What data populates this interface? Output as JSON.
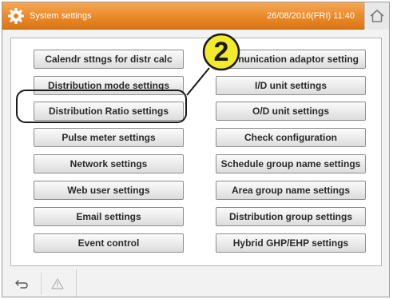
{
  "header": {
    "title": "System settings",
    "datetime": "26/08/2016(FRI) 11:40",
    "gear_icon": "gear-icon",
    "home_icon": "home-icon",
    "accent_color": "#ea8c2c"
  },
  "settings": {
    "left": [
      "Calendr sttngs for distr calc",
      "Distribution mode settings",
      "Distribution Ratio settings",
      "Pulse meter settings",
      "Network settings",
      "Web user settings",
      "Email settings",
      "Event control"
    ],
    "right": [
      "nunication adaptor setting",
      "I/D unit settings",
      "O/D unit settings",
      "Check configuration",
      "Schedule group name settings",
      "Area group name settings",
      "Distribution group settings",
      "Hybrid GHP/EHP settings"
    ]
  },
  "callout": {
    "number": "2",
    "color": "#f2ea2c",
    "highlighted_item": "Distribution Ratio settings"
  },
  "footer": {
    "back_icon": "back-arrow-icon",
    "warning_icon": "warning-icon"
  }
}
